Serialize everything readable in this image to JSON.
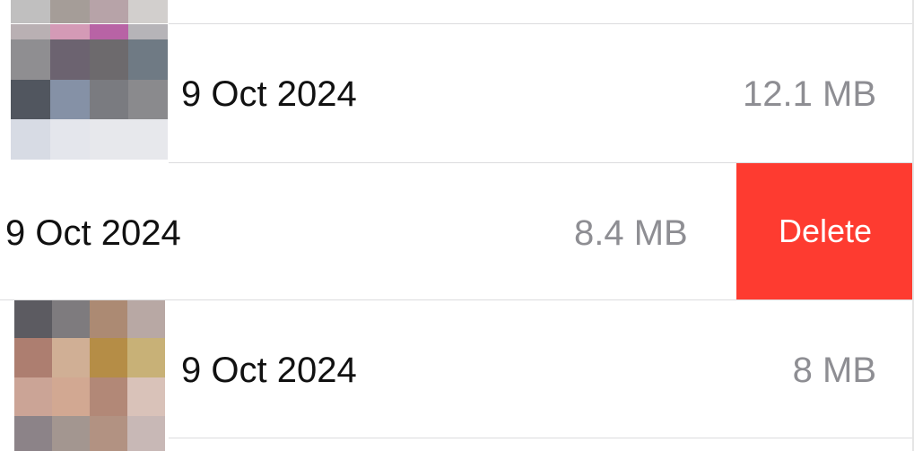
{
  "files": [
    {
      "date": "",
      "size": "",
      "thumbnail": [
        "#c0bfbf",
        "#a59d98",
        "#b7a3a8",
        "#d2cfcd"
      ]
    },
    {
      "date": "9 Oct 2024",
      "size": "12.1 MB",
      "thumbnail": [
        "#b9b0b3",
        "#d49ab6",
        "#b863a5",
        "#b6b4b8",
        "#8f8e91",
        "#6c6370",
        "#6d6a6d",
        "#6f7a84",
        "#51565f",
        "#8591a6",
        "#7a7b80",
        "#8a8a8d",
        "#d7dbe4",
        "#e4e6ec",
        "#e7e8ec",
        "#e7e8ec"
      ]
    },
    {
      "date": "9 Oct 2024",
      "size": "8.4 MB",
      "swiped": true,
      "action_label": "Delete"
    },
    {
      "date": "9 Oct 2024",
      "size": "8 MB",
      "thumbnail": [
        "#5c5b61",
        "#7e7b7e",
        "#ac8a73",
        "#b8a8a4",
        "#ad7e70",
        "#d0af95",
        "#b58d46",
        "#c8b177",
        "#cba496",
        "#d2a892",
        "#b28877",
        "#d9c2b9",
        "#8c8388",
        "#a39690",
        "#b29282",
        "#c8b8b6"
      ]
    }
  ],
  "colors": {
    "delete": "#fe3b30",
    "separator": "#dcdcde",
    "size_text": "#8e8e93"
  }
}
